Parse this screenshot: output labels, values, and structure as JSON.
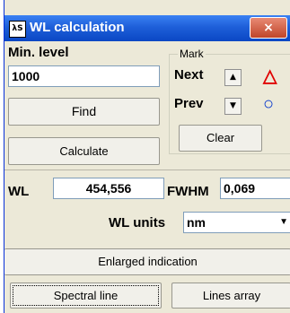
{
  "window": {
    "title": "WL calculation",
    "icon_text": "λS",
    "close_label": "×"
  },
  "min_level": {
    "label": "Min. level",
    "value": "1000"
  },
  "buttons": {
    "find": "Find",
    "calculate": "Calculate",
    "clear": "Clear",
    "enlarged": "Enlarged indication",
    "spectral_line": "Spectral line",
    "lines_array": "Lines array"
  },
  "mark": {
    "group_label": "Mark",
    "next_label": "Next",
    "prev_label": "Prev",
    "up_arrow": "▲",
    "down_arrow": "▼",
    "triangle_marker": "△",
    "circle_marker": "○",
    "triangle_color": "#e00000",
    "circle_color": "#0033cc"
  },
  "results": {
    "wl_label": "WL",
    "wl_value": "454,556",
    "fwhm_label": "FWHM",
    "fwhm_value": "0,069"
  },
  "units": {
    "label": "WL units",
    "value": "nm",
    "dropdown_arrow": "▼"
  }
}
